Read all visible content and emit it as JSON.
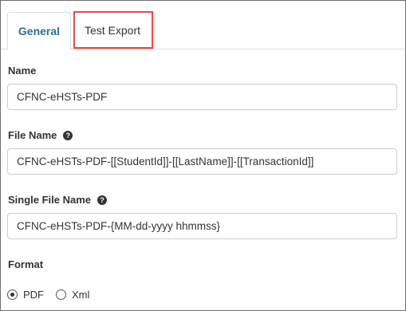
{
  "tabs": {
    "general": "General",
    "test_export": "Test Export"
  },
  "fields": {
    "name": {
      "label": "Name",
      "value": "CFNC-eHSTs-PDF"
    },
    "file_name": {
      "label": "File Name",
      "value": "CFNC-eHSTs-PDF-[[StudentId]]-[[LastName]]-[[TransactionId]]"
    },
    "single_file_name": {
      "label": "Single File Name",
      "value": "CFNC-eHSTs-PDF-{MM-dd-yyyy hhmmss}"
    },
    "format": {
      "label": "Format",
      "options": [
        "PDF",
        "Xml"
      ],
      "selected": "PDF"
    }
  },
  "icons": {
    "help": "question-circle-icon"
  },
  "colors": {
    "active_tab_text": "#2a6e99",
    "highlight_border": "#e24e4e"
  }
}
